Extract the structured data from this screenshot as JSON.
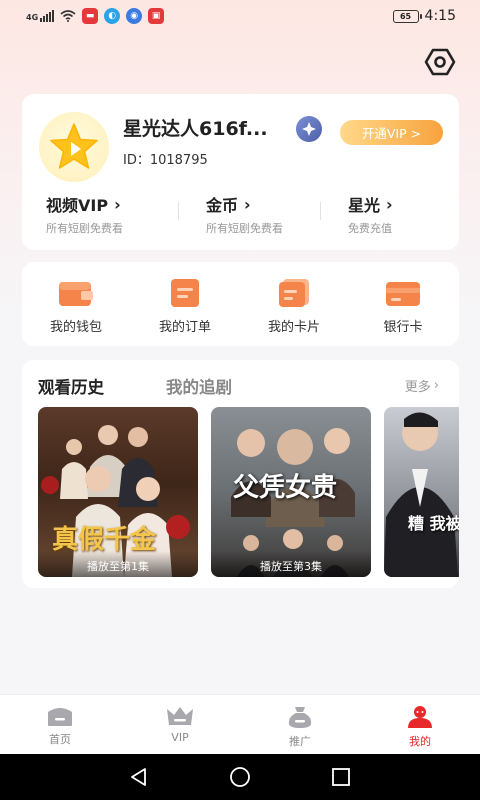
{
  "status_bar": {
    "network": "4G",
    "battery": "65",
    "time": "4:15"
  },
  "profile": {
    "username": "星光达人616f...",
    "id_text": "ID：1018795",
    "vip_button": "开通VIP >",
    "stats": [
      {
        "title": "视频VIP",
        "sub": "所有短剧免费看"
      },
      {
        "title": "金币",
        "sub": "所有短剧免费看"
      },
      {
        "title": "星光",
        "sub": "免费充值"
      }
    ]
  },
  "tools": [
    {
      "label": "我的钱包",
      "icon": "wallet-icon"
    },
    {
      "label": "我的订单",
      "icon": "order-icon"
    },
    {
      "label": "我的卡片",
      "icon": "card-icon"
    },
    {
      "label": "银行卡",
      "icon": "bank-card-icon"
    }
  ],
  "history": {
    "tab_active": "观看历史",
    "tab_inactive": "我的追剧",
    "more": "更多",
    "posters": [
      {
        "title": "真假千金",
        "progress": "播放至第1集"
      },
      {
        "title": "父凭女贵",
        "progress": "播放至第3集"
      },
      {
        "title": "糟 我被",
        "progress": ""
      }
    ]
  },
  "bottom_nav": [
    {
      "label": "首页",
      "icon": "home-icon"
    },
    {
      "label": "VIP",
      "icon": "crown-icon"
    },
    {
      "label": "推广",
      "icon": "promote-icon"
    },
    {
      "label": "我的",
      "icon": "profile-icon"
    }
  ],
  "colors": {
    "accent": "#e8282b",
    "vip_gradient_start": "#ffd98a",
    "vip_gradient_end": "#f7a33d",
    "tool_orange": "#f5844a"
  }
}
